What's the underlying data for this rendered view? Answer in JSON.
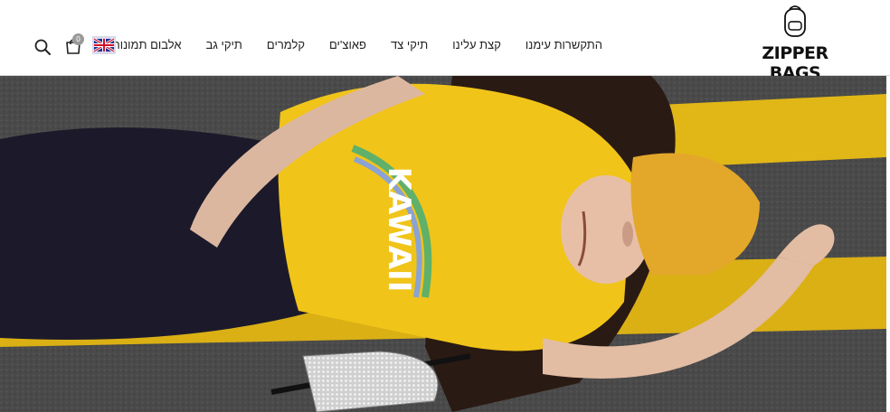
{
  "brand": {
    "logo_text": "ZIPPER BAGS"
  },
  "nav": {
    "items": [
      {
        "label": "אלבום תמונות"
      },
      {
        "label": "תיקי גב"
      },
      {
        "label": "קלמרים"
      },
      {
        "label": "פאוצ'ים"
      },
      {
        "label": "תיקי צד"
      },
      {
        "label": "קצת עלינו"
      },
      {
        "label": "התקשרות עימנו"
      }
    ]
  },
  "header_icons": {
    "flag": "uk-flag-icon",
    "cart": "shopping-bag-icon",
    "cart_count": "0",
    "search": "search-icon"
  },
  "hero": {
    "shirt_text": "KAWAII",
    "colors": {
      "road": "#4b4b4b",
      "stripe": "#e9bd14",
      "shirt": "#f0c419",
      "jeans": "#1c1a2a"
    }
  }
}
